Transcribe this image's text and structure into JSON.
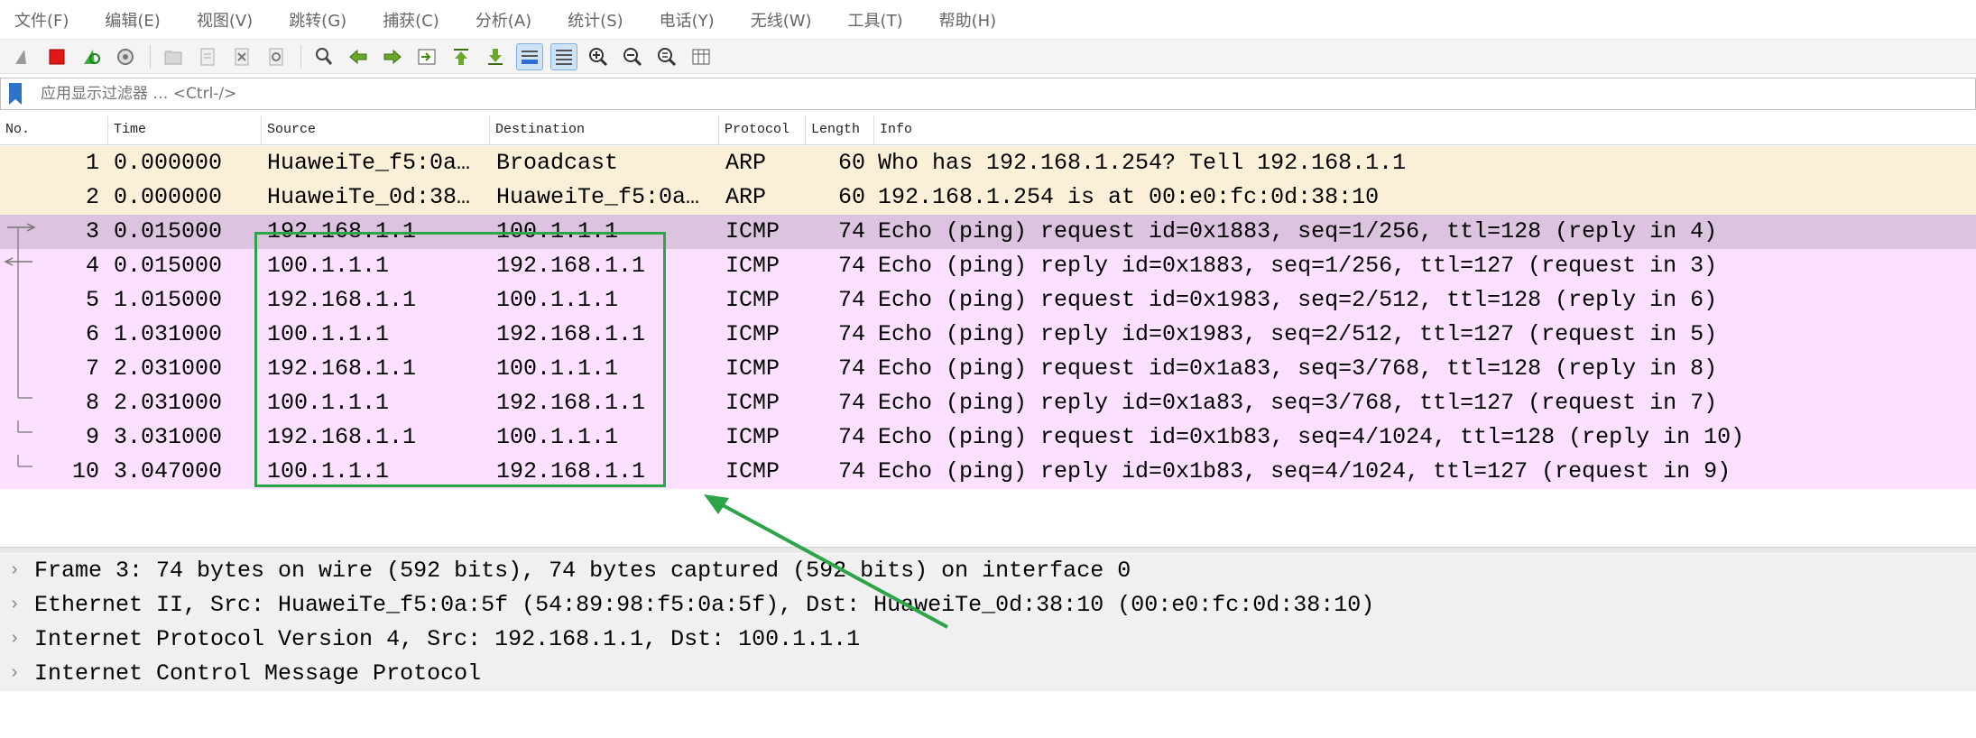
{
  "menu": [
    "文件(F)",
    "编辑(E)",
    "视图(V)",
    "跳转(G)",
    "捕获(C)",
    "分析(A)",
    "统计(S)",
    "电话(Y)",
    "无线(W)",
    "工具(T)",
    "帮助(H)"
  ],
  "toolbar": {
    "icons": [
      "shark-fin-icon",
      "stop-capture-icon",
      "restart-capture-icon",
      "capture-options-icon",
      "open-file-icon",
      "save-file-icon",
      "close-file-icon",
      "reload-file-icon",
      "find-packet-icon",
      "go-back-icon",
      "go-forward-icon",
      "go-to-packet-icon",
      "first-packet-icon",
      "last-packet-icon",
      "autoscroll-icon",
      "colorize-icon",
      "zoom-in-icon",
      "zoom-out-icon",
      "zoom-reset-icon",
      "resize-columns-icon"
    ]
  },
  "filter": {
    "placeholder": "应用显示过滤器 … <Ctrl-/>"
  },
  "columns": {
    "no": "No.",
    "time": "Time",
    "source": "Source",
    "destination": "Destination",
    "protocol": "Protocol",
    "length": "Length",
    "info": "Info"
  },
  "packets": [
    {
      "no": "1",
      "time": "0.000000",
      "source": "HuaweiTe_f5:0a…",
      "destination": "Broadcast",
      "protocol": "ARP",
      "length": "60",
      "info": "Who has 192.168.1.254? Tell 192.168.1.1"
    },
    {
      "no": "2",
      "time": "0.000000",
      "source": "HuaweiTe_0d:38…",
      "destination": "HuaweiTe_f5:0a…",
      "protocol": "ARP",
      "length": "60",
      "info": "192.168.1.254 is at 00:e0:fc:0d:38:10"
    },
    {
      "no": "3",
      "time": "0.015000",
      "source": "192.168.1.1",
      "destination": "100.1.1.1",
      "protocol": "ICMP",
      "length": "74",
      "info": "Echo (ping) request  id=0x1883, seq=1/256, ttl=128 (reply in 4)"
    },
    {
      "no": "4",
      "time": "0.015000",
      "source": "100.1.1.1",
      "destination": "192.168.1.1",
      "protocol": "ICMP",
      "length": "74",
      "info": "Echo (ping) reply    id=0x1883, seq=1/256, ttl=127 (request in 3)"
    },
    {
      "no": "5",
      "time": "1.015000",
      "source": "192.168.1.1",
      "destination": "100.1.1.1",
      "protocol": "ICMP",
      "length": "74",
      "info": "Echo (ping) request  id=0x1983, seq=2/512, ttl=128 (reply in 6)"
    },
    {
      "no": "6",
      "time": "1.031000",
      "source": "100.1.1.1",
      "destination": "192.168.1.1",
      "protocol": "ICMP",
      "length": "74",
      "info": "Echo (ping) reply    id=0x1983, seq=2/512, ttl=127 (request in 5)"
    },
    {
      "no": "7",
      "time": "2.031000",
      "source": "192.168.1.1",
      "destination": "100.1.1.1",
      "protocol": "ICMP",
      "length": "74",
      "info": "Echo (ping) request  id=0x1a83, seq=3/768, ttl=128 (reply in 8)"
    },
    {
      "no": "8",
      "time": "2.031000",
      "source": "100.1.1.1",
      "destination": "192.168.1.1",
      "protocol": "ICMP",
      "length": "74",
      "info": "Echo (ping) reply    id=0x1a83, seq=3/768, ttl=127 (request in 7)"
    },
    {
      "no": "9",
      "time": "3.031000",
      "source": "192.168.1.1",
      "destination": "100.1.1.1",
      "protocol": "ICMP",
      "length": "74",
      "info": "Echo (ping) request  id=0x1b83, seq=4/1024, ttl=128 (reply in 10)"
    },
    {
      "no": "10",
      "time": "3.047000",
      "source": "100.1.1.1",
      "destination": "192.168.1.1",
      "protocol": "ICMP",
      "length": "74",
      "info": "Echo (ping) reply    id=0x1b83, seq=4/1024, ttl=127 (request in 9)"
    }
  ],
  "details": [
    "Frame 3: 74 bytes on wire (592 bits), 74 bytes captured (592 bits) on interface 0",
    "Ethernet II, Src: HuaweiTe_f5:0a:5f (54:89:98:f5:0a:5f), Dst: HuaweiTe_0d:38:10 (00:e0:fc:0d:38:10)",
    "Internet Protocol Version 4, Src: 192.168.1.1, Dst: 100.1.1.1",
    "Internet Control Message Protocol"
  ],
  "colors": {
    "arp_row": "#faf0d7",
    "icmp_row": "#fce0ff",
    "selected_row": "#dcc3df",
    "annotation": "#2ca447"
  }
}
